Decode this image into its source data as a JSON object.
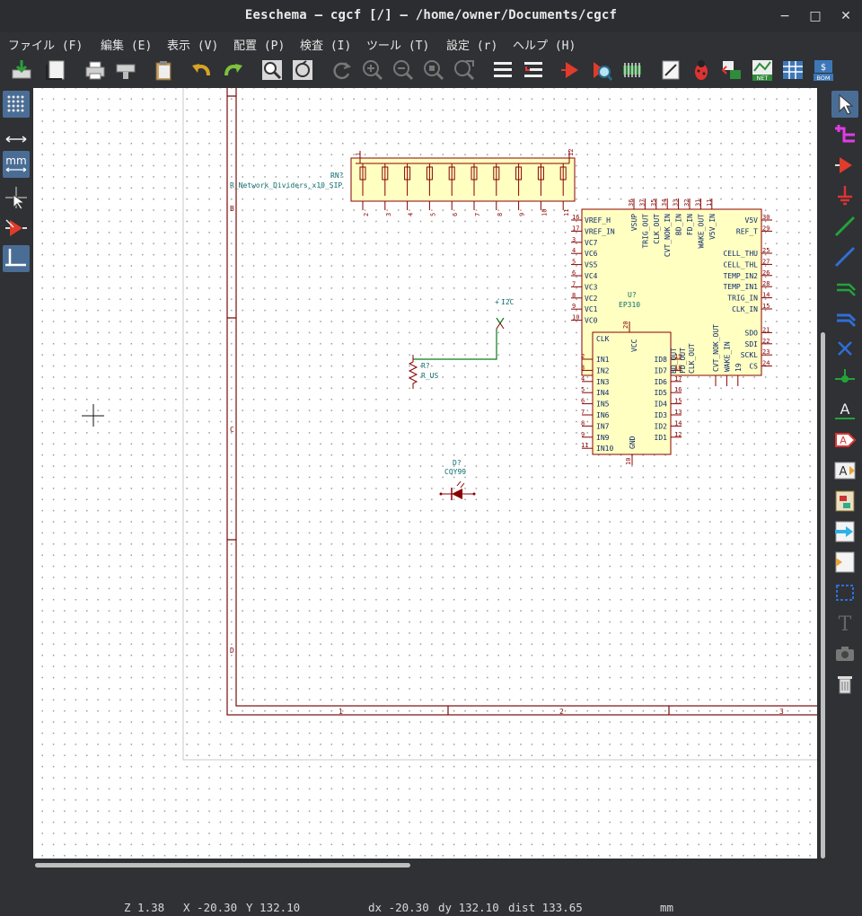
{
  "window": {
    "title": "Eeschema — cgcf [/] — /home/owner/Documents/cgcf",
    "min_glyph": "−",
    "max_glyph": "□",
    "close_glyph": "✕"
  },
  "menu": [
    {
      "label": "ファイル (F)"
    },
    {
      "label": "編集 (E)"
    },
    {
      "label": "表示 (V)"
    },
    {
      "label": "配置 (P)"
    },
    {
      "label": "検査 (I)"
    },
    {
      "label": "ツール (T)"
    },
    {
      "label": "設定 (r)"
    },
    {
      "label": "ヘルプ (H)"
    }
  ],
  "toolbar_icons": [
    "save-icon",
    "page-settings-icon",
    "print-icon",
    "plot-icon",
    "paste-icon",
    "undo-icon",
    "redo-icon",
    "find-icon",
    "find-replace-icon",
    "refresh-icon",
    "zoom-in-icon",
    "zoom-out-icon",
    "zoom-fit-icon",
    "zoom-selection-icon",
    "hierarchy-navigator-icon",
    "leave-sheet-icon",
    "symbol-editor-icon",
    "symbol-browser-icon",
    "footprint-editor-icon",
    "annotate-icon",
    "erc-icon",
    "assign-footprints-icon",
    "netlist-icon",
    "bom-table-icon",
    "bom-icon"
  ],
  "toolbar_labels": {
    "netlist": "NET",
    "bom": "BOM"
  },
  "left_toolbar_icons": [
    "grid-toggle-icon",
    "polar-coords-icon",
    "units-mm-icon",
    "cursor-style-icon",
    "hidden-pins-icon",
    "wire-angle-icon"
  ],
  "left_toolbar_labels": {
    "units": "mm"
  },
  "right_toolbar_icons": [
    "select-icon",
    "highlight-net-icon",
    "add-symbol-icon",
    "add-power-icon",
    "add-wire-icon",
    "add-bus-icon",
    "wire-to-bus-entry-icon",
    "bus-to-bus-entry-icon",
    "no-connect-icon",
    "junction-icon",
    "net-label-icon",
    "global-label-icon",
    "hierarchical-label-icon",
    "hierarchical-sheet-icon",
    "import-sheet-pin-icon",
    "add-sheet-pin-icon",
    "graphic-lines-icon",
    "text-icon",
    "image-icon",
    "delete-icon"
  ],
  "right_toolbar_labels": {
    "net_label": "A",
    "global_label": "A",
    "hier_label": "A",
    "text": "T"
  },
  "schematic": {
    "border_rows": [
      "B",
      "C",
      "D"
    ],
    "border_cols": [
      "1",
      "2",
      "3"
    ],
    "rn": {
      "ref": "RN?",
      "value": "R_Network_Dividers_x10_SIP",
      "pin_first": "1",
      "pin_last": "12",
      "bottom_pins": [
        "2",
        "3",
        "4",
        "5",
        "6",
        "7",
        "8",
        "9",
        "10",
        "11"
      ]
    },
    "ep": {
      "ref": "U?",
      "value": "EP310",
      "left_pins": [
        {
          "num": "16",
          "name": "VREF_H"
        },
        {
          "num": "17",
          "name": "VREF_IN"
        },
        {
          "num": "3",
          "name": "VC7"
        },
        {
          "num": "4",
          "name": "VC6"
        },
        {
          "num": "5",
          "name": "VS5"
        },
        {
          "num": "6",
          "name": "VC4"
        },
        {
          "num": "7",
          "name": "VC3"
        },
        {
          "num": "8",
          "name": "VC2"
        },
        {
          "num": "9",
          "name": "VC1"
        },
        {
          "num": "10",
          "name": "VC0"
        }
      ],
      "right_pins": [
        {
          "num": "30",
          "name": "V5V"
        },
        {
          "num": "29",
          "name": "REF_T"
        },
        {
          "num": "25",
          "name": "CELL_THU"
        },
        {
          "num": "27",
          "name": "CELL_THL"
        },
        {
          "num": "26",
          "name": "TEMP_IN2"
        },
        {
          "num": "28",
          "name": "TEMP_IN1"
        },
        {
          "num": "14",
          "name": "TRIG_IN"
        },
        {
          "num": "15",
          "name": "CLK_IN"
        },
        {
          "num": "21",
          "name": "SDO"
        },
        {
          "num": "22",
          "name": "SDI"
        },
        {
          "num": "23",
          "name": "SCKL"
        },
        {
          "num": "24",
          "name": "CS"
        }
      ],
      "top_pins": [
        {
          "num": "36",
          "name": "VSUP"
        },
        {
          "num": "37",
          "name": "TRIG_OUT"
        },
        {
          "num": "35",
          "name": "CLK_OUT"
        },
        {
          "num": "34",
          "name": "CVT_NOK_IN"
        },
        {
          "num": "33",
          "name": "BD_IN"
        },
        {
          "num": "32",
          "name": "FD_IN"
        },
        {
          "num": "31",
          "name": "WAKE_OUT"
        },
        {
          "num": "11",
          "name": "V5V_IN"
        }
      ],
      "bottom_labels": [
        "CVT_NOK_OUT",
        "WAKE_IN",
        "19"
      ]
    },
    "mux": {
      "top_names": [
        "CLK",
        "VCC"
      ],
      "left_pins": [
        {
          "num": "2",
          "name": "IN1"
        },
        {
          "num": "3",
          "name": "IN2"
        },
        {
          "num": "4",
          "name": "IN3"
        },
        {
          "num": "5",
          "name": "IN4"
        },
        {
          "num": "6",
          "name": "IN5"
        },
        {
          "num": "7",
          "name": "IN6"
        },
        {
          "num": "8",
          "name": "IN7"
        },
        {
          "num": "9",
          "name": "IN9"
        },
        {
          "num": "11",
          "name": "IN10"
        }
      ],
      "right_pins": [
        {
          "num": "19",
          "name": "ID8"
        },
        {
          "num": "18",
          "name": "ID7"
        },
        {
          "num": "17",
          "name": "ID6"
        },
        {
          "num": "16",
          "name": "ID5"
        },
        {
          "num": "15",
          "name": "ID4"
        },
        {
          "num": "13",
          "name": "ID3"
        },
        {
          "num": "14",
          "name": "ID2"
        },
        {
          "num": "12",
          "name": "ID1"
        }
      ],
      "gnd_name": "GND",
      "gnd_num": "10",
      "vcc_num": "20",
      "overlap_names": [
        "BD_OUT",
        "FD_OUT",
        "CLK_OUT"
      ]
    },
    "label_i2c": "I2C",
    "resistor": {
      "ref": "R?",
      "value": "R_US"
    },
    "diode": {
      "ref": "D?",
      "value": "CQY99"
    }
  },
  "status": {
    "zoom": "Z 1.38",
    "x": "X -20.30",
    "y": "Y 132.10",
    "dx": "dx -20.30",
    "dy": "dy 132.10",
    "dist": "dist 133.65",
    "units": "mm"
  }
}
